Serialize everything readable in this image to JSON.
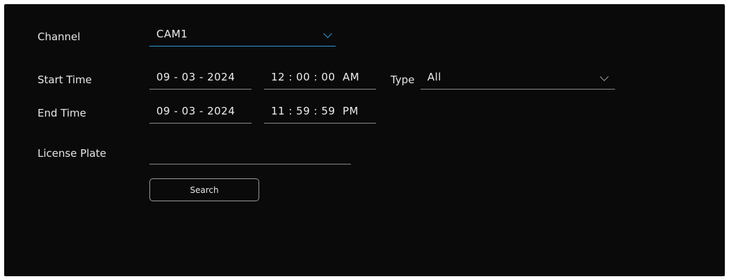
{
  "form": {
    "channel": {
      "label": "Channel",
      "value": "CAM1"
    },
    "start_time": {
      "label": "Start Time",
      "date": "09 - 03 - 2024",
      "time": "12 : 00 : 00  AM"
    },
    "type": {
      "label": "Type",
      "value": "All"
    },
    "end_time": {
      "label": "End Time",
      "date": "09 - 03 - 2024",
      "time": "11 : 59 : 59  PM"
    },
    "license_plate": {
      "label": "License Plate",
      "value": ""
    },
    "search_button": "Search"
  },
  "colors": {
    "background": "#0a0a0b",
    "accent": "#2f9bd6",
    "underline": "#8a8a8a"
  },
  "icons": {
    "dropdown": "chevron-down-icon"
  }
}
